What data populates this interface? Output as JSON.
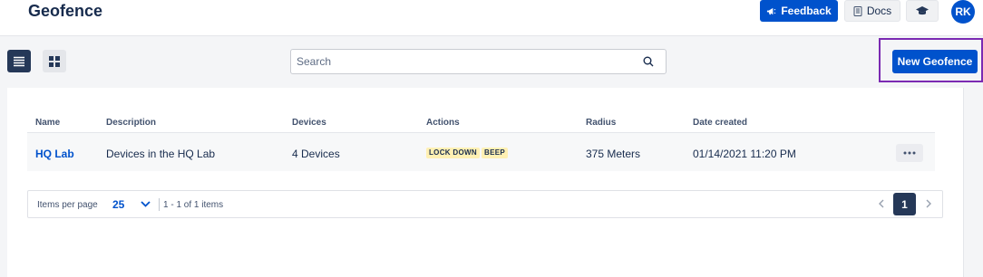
{
  "header": {
    "title": "Geofence",
    "feedback_label": "Feedback",
    "docs_label": "Docs",
    "avatar_initials": "RK"
  },
  "toolbar": {
    "search_placeholder": "Search",
    "new_button_label": "New Geofence"
  },
  "table": {
    "columns": [
      "Name",
      "Description",
      "Devices",
      "Actions",
      "Radius",
      "Date created"
    ],
    "rows": [
      {
        "name": "HQ Lab",
        "description": "Devices in the HQ Lab",
        "devices": "4 Devices",
        "actions": [
          "LOCK DOWN",
          "BEEP"
        ],
        "radius": "375 Meters",
        "date_created": "01/14/2021 11:20 PM"
      }
    ]
  },
  "pagination": {
    "items_per_page_label": "Items per page",
    "page_size": "25",
    "range_text": "1 - 1 of 1 items",
    "current_page": "1"
  },
  "colors": {
    "primary": "#0052cc",
    "dark": "#253858",
    "highlight": "#7b2ab2",
    "tag_bg": "#fff0b3"
  }
}
